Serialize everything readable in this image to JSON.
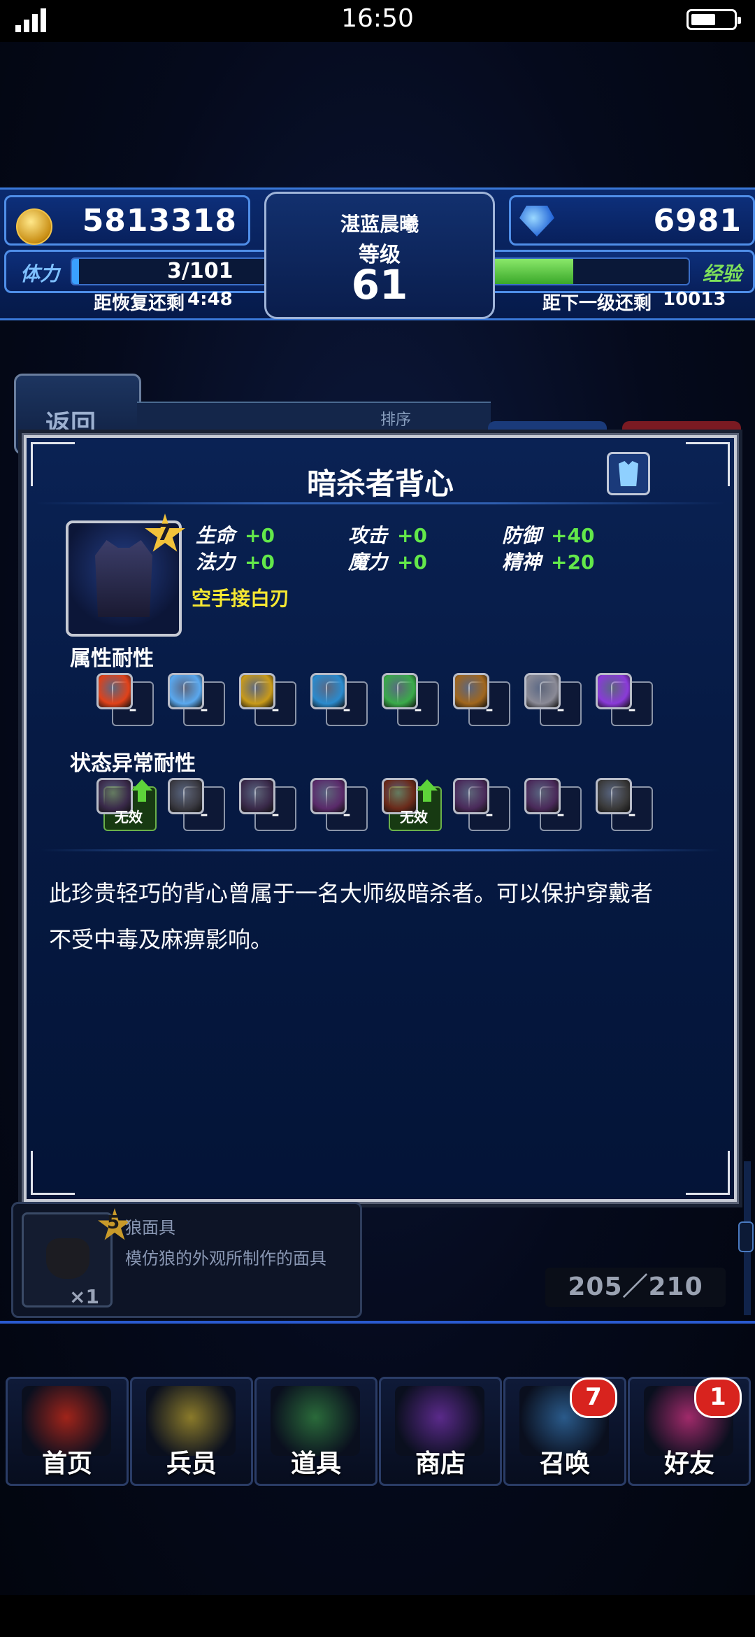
{
  "status_bar": {
    "time": "16:50"
  },
  "hud": {
    "gil": "5813318",
    "player_name": "湛蓝晨曦",
    "level_label": "等级",
    "level": "61",
    "gems": "6981",
    "stamina_label": "体力",
    "stamina": "3/101",
    "stamina_fill": 0.03,
    "stamina_recover_label": "距恢复还剩",
    "stamina_recover_time": "4:48",
    "exp_label": "经验",
    "exp_fill": 0.5,
    "next_level_label": "距下一级还剩",
    "next_level_remaining": "10013"
  },
  "back_button": "返回",
  "behind_tabs": {
    "sort_label": "排序"
  },
  "modal": {
    "title": "暗杀者背心",
    "item_rarity": "7",
    "stats": [
      {
        "label": "生命",
        "value": "+0"
      },
      {
        "label": "攻击",
        "value": "+0"
      },
      {
        "label": "防御",
        "value": "+40"
      },
      {
        "label": "法力",
        "value": "+0"
      },
      {
        "label": "魔力",
        "value": "+0"
      },
      {
        "label": "精神",
        "value": "+20"
      }
    ],
    "ability": "空手接白刃",
    "elemental_resist_label": "属性耐性",
    "elemental_resists": [
      {
        "icon": "fire-icon",
        "color": "#e0421a",
        "value": "–"
      },
      {
        "icon": "ice-icon",
        "color": "#5aa8ee",
        "value": "–"
      },
      {
        "icon": "lightning-icon",
        "color": "#c89a1a",
        "value": "–"
      },
      {
        "icon": "water-icon",
        "color": "#2a8acd",
        "value": "–"
      },
      {
        "icon": "wind-icon",
        "color": "#3aaa4a",
        "value": "–"
      },
      {
        "icon": "earth-icon",
        "color": "#a0661e",
        "value": "–"
      },
      {
        "icon": "light-icon",
        "color": "#8a8a96",
        "value": "–"
      },
      {
        "icon": "dark-icon",
        "color": "#8a3ad8",
        "value": "–"
      }
    ],
    "status_resist_label": "状态异常耐性",
    "status_resists": [
      {
        "icon": "poison-icon",
        "color": "#3a2a4a",
        "value": "无效",
        "immune": true
      },
      {
        "icon": "blind-icon",
        "color": "#3a3a42",
        "value": "–",
        "immune": false
      },
      {
        "icon": "sleep-icon",
        "color": "#3a2a4a",
        "value": "–",
        "immune": false
      },
      {
        "icon": "silence-icon",
        "color": "#5a2a6a",
        "value": "–",
        "immune": false
      },
      {
        "icon": "paralyze-icon",
        "color": "#6a2a1a",
        "value": "无效",
        "immune": true
      },
      {
        "icon": "confuse-icon",
        "color": "#4a2a5a",
        "value": "–",
        "immune": false
      },
      {
        "icon": "disease-icon",
        "color": "#4a2a5a",
        "value": "–",
        "immune": false
      },
      {
        "icon": "petrify-icon",
        "color": "#3a3a3a",
        "value": "–",
        "immune": false
      }
    ],
    "description_line1": "此珍贵轻巧的背心曾属于一名大师级暗杀者。可以保护穿戴者",
    "description_line2": "不受中毒及麻痹影响。"
  },
  "list_item": {
    "rarity": "5",
    "name": "狼面具",
    "description": "模仿狼的外观所制作的面具",
    "quantity": "×1"
  },
  "inventory_count": "205／210",
  "nav": [
    {
      "label": "首页",
      "art": "home-art",
      "color": "#a0241a",
      "badge": ""
    },
    {
      "label": "兵员",
      "art": "units-art",
      "color": "#8a7a2a",
      "badge": ""
    },
    {
      "label": "道具",
      "art": "items-art",
      "color": "#2a6a3a",
      "badge": ""
    },
    {
      "label": "商店",
      "art": "shop-art",
      "color": "#5a2a8a",
      "badge": ""
    },
    {
      "label": "召唤",
      "art": "summon-art",
      "color": "#2a5a8a",
      "badge": "7"
    },
    {
      "label": "好友",
      "art": "friends-art",
      "color": "#a02a6a",
      "badge": "1"
    }
  ]
}
